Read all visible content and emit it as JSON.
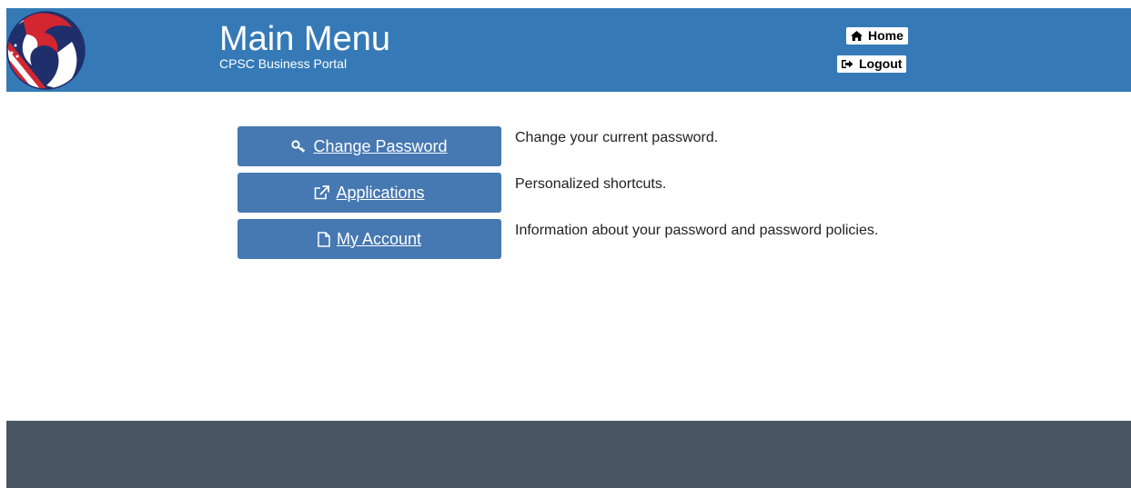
{
  "header": {
    "title": "Main Menu",
    "subtitle": "CPSC Business Portal",
    "home_label": "Home",
    "logout_label": "Logout",
    "background_color": "#357ab7",
    "logo_icon": "cpsc-eagle-logo"
  },
  "menu": {
    "items": [
      {
        "label": "Change Password",
        "icon": "key-icon",
        "description": "Change your current password."
      },
      {
        "label": "Applications",
        "icon": "external-link-icon",
        "description": "Personalized shortcuts."
      },
      {
        "label": "My Account",
        "icon": "file-icon",
        "description": "Information about your password and password policies."
      }
    ],
    "button_color": "#4678b2"
  },
  "footer": {
    "background_color": "#4a5563"
  }
}
